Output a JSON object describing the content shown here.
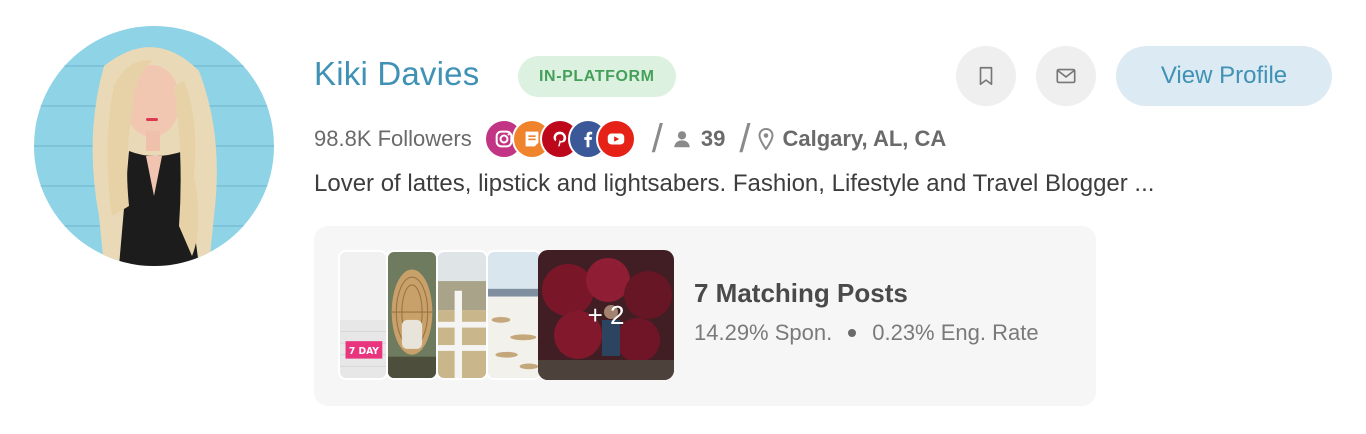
{
  "profile": {
    "name": "Kiki Davies",
    "badge": "IN-PLATFORM",
    "view_profile_label": "View Profile",
    "followers": "98.8K Followers",
    "reach": "39",
    "location": "Calgary, AL, CA",
    "bio": "Lover of lattes, lipstick and lightsabers. Fashion, Lifestyle and Travel Blogger ..."
  },
  "social_platforms": [
    {
      "icon": "instagram-icon",
      "color": "#c13584"
    },
    {
      "icon": "blog-icon",
      "color": "#f0842c"
    },
    {
      "icon": "pinterest-icon",
      "color": "#bd081c"
    },
    {
      "icon": "facebook-icon",
      "color": "#3b5998"
    },
    {
      "icon": "youtube-icon",
      "color": "#e62117"
    }
  ],
  "matching_posts": {
    "title": "7 Matching Posts",
    "more_count": "+ 2",
    "thumb_label": "7 DAY",
    "sponsored": "14.29% Spon.",
    "engagement": "0.23% Eng. Rate"
  },
  "colors": {
    "accent": "#3f91b5",
    "badge_bg": "#dcf1df",
    "badge_text": "#45a05b",
    "button_bg": "#dcebf3"
  }
}
